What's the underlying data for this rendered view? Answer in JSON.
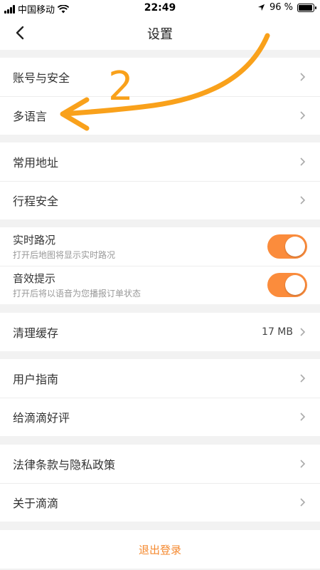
{
  "status_bar": {
    "carrier": "中国移动",
    "time": "22:49",
    "battery_text": "96 %",
    "battery_level": 0.96
  },
  "nav": {
    "title": "设置"
  },
  "groups": [
    {
      "rows": [
        {
          "label": "账号与安全"
        },
        {
          "label": "多语言"
        }
      ]
    },
    {
      "rows": [
        {
          "label": "常用地址"
        },
        {
          "label": "行程安全"
        }
      ]
    },
    {
      "rows": [
        {
          "label": "实时路况",
          "sublabel": "打开后地图将显示实时路况",
          "toggle_on": true
        },
        {
          "label": "音效提示",
          "sublabel": "打开后将以语音为您播报订单状态",
          "toggle_on": true
        }
      ]
    },
    {
      "rows": [
        {
          "label": "清理缓存",
          "value": "17 MB"
        }
      ]
    },
    {
      "rows": [
        {
          "label": "用户指南"
        },
        {
          "label": "给滴滴好评"
        }
      ]
    },
    {
      "rows": [
        {
          "label": "法律条款与隐私政策"
        },
        {
          "label": "关于滴滴"
        }
      ]
    }
  ],
  "logout_label": "退出登录",
  "annotation": {
    "number": "2",
    "color": "#f9a11b"
  },
  "colors": {
    "accent": "#fb8c3c",
    "logout_text": "#f5892f"
  }
}
